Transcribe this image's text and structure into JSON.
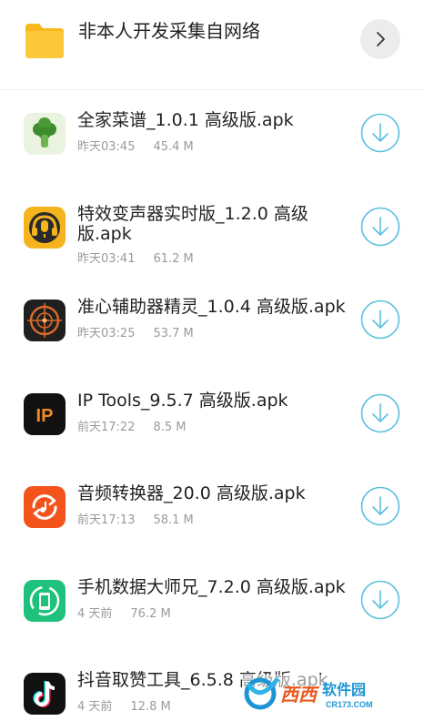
{
  "folder": {
    "name": "非本人开发采集自网络"
  },
  "files": [
    {
      "name": "全家菜谱_1.0.1 高级版.apk",
      "time": "昨天03:45",
      "size": "45.4 M",
      "icon": "broccoli-icon"
    },
    {
      "name": "特效变声器实时版_1.2.0 高级版.apk",
      "time": "昨天03:41",
      "size": "61.2 M",
      "icon": "headphone-mic-icon"
    },
    {
      "name": "准心辅助器精灵_1.0.4 高级版.apk",
      "time": "昨天03:25",
      "size": "53.7 M",
      "icon": "crosshair-icon"
    },
    {
      "name": "IP Tools_9.5.7 高级版.apk",
      "time": "前天17:22",
      "size": "8.5 M",
      "icon": "ip-tools-icon",
      "icon_text": "IP"
    },
    {
      "name": "音频转换器_20.0 高级版.apk",
      "time": "前天17:13",
      "size": "58.1 M",
      "icon": "audio-convert-icon"
    },
    {
      "name": "手机数据大师兄_7.2.0 高级版.apk",
      "time": "4 天前",
      "size": "76.2 M",
      "icon": "phone-sync-icon"
    },
    {
      "name": "抖音取赞工具_6.5.8 高级版.apk",
      "time": "4 天前",
      "size": "12.8 M",
      "icon": "tiktok-icon"
    }
  ],
  "watermark": {
    "brand": "西西",
    "text": "软件园",
    "domain": "CR173.COM"
  },
  "colors": {
    "accent": "#5bc0de",
    "folder": "#fcc12e",
    "meta": "#9a9a9a"
  }
}
